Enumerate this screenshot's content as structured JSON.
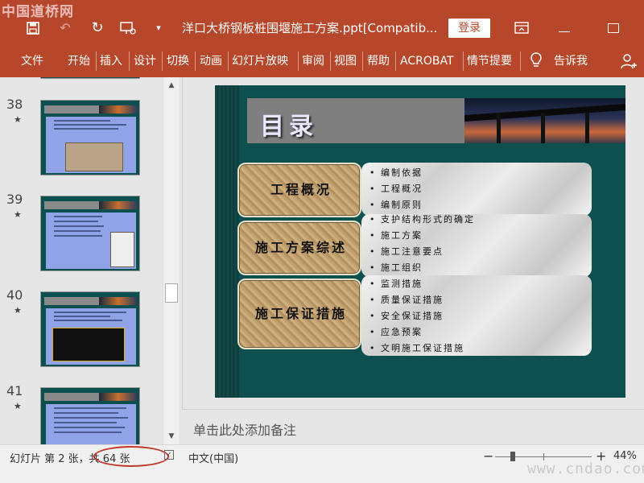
{
  "watermark": "中国道桥网",
  "titlebar": {
    "document_title": "洋口大桥钢板桩围堰施工方案.ppt[Compatib...",
    "login_label": "登录",
    "save_icon": "save-icon",
    "undo_icon": "undo-icon",
    "redo_icon": "redo-icon",
    "present_icon": "from-beginning-icon",
    "customize_qat_icon": "chevron-down-icon"
  },
  "ribbon": {
    "tabs": [
      "文件",
      "开始",
      "插入",
      "设计",
      "切换",
      "动画",
      "幻灯片放映",
      "审阅",
      "视图",
      "帮助",
      "ACROBAT",
      "情节提要"
    ],
    "tell_me": "告诉我"
  },
  "thumbnails": [
    {
      "number": "38",
      "star": "★"
    },
    {
      "number": "39",
      "star": "★"
    },
    {
      "number": "40",
      "star": "★"
    },
    {
      "number": "41",
      "star": "★"
    }
  ],
  "slide": {
    "title": "目录",
    "sections": [
      {
        "label": "工程概况",
        "bullets": [
          "编制依据",
          "工程概况",
          "编制原则"
        ]
      },
      {
        "label": "施工方案综述",
        "bullets": [
          "支护结构形式的确定",
          "施工方案",
          "施工注意要点",
          "施工组织"
        ]
      },
      {
        "label": "施工保证措施",
        "bullets": [
          "监测措施",
          "质量保证措施",
          "安全保证措施",
          "应急预案",
          "文明施工保证措施"
        ]
      }
    ]
  },
  "notes": {
    "placeholder": "单击此处添加备注"
  },
  "status": {
    "slide_info": "幻灯片 第 2 张，共 64 张",
    "language": "中文(中国)",
    "zoom": "44%",
    "zoom_minus": "−",
    "zoom_plus": "+"
  },
  "site_watermark": "www.cndao.com",
  "colors": {
    "accent": "#b7472a",
    "slide_bg": "#0e5050",
    "highlight_circle": "#c0392b"
  }
}
